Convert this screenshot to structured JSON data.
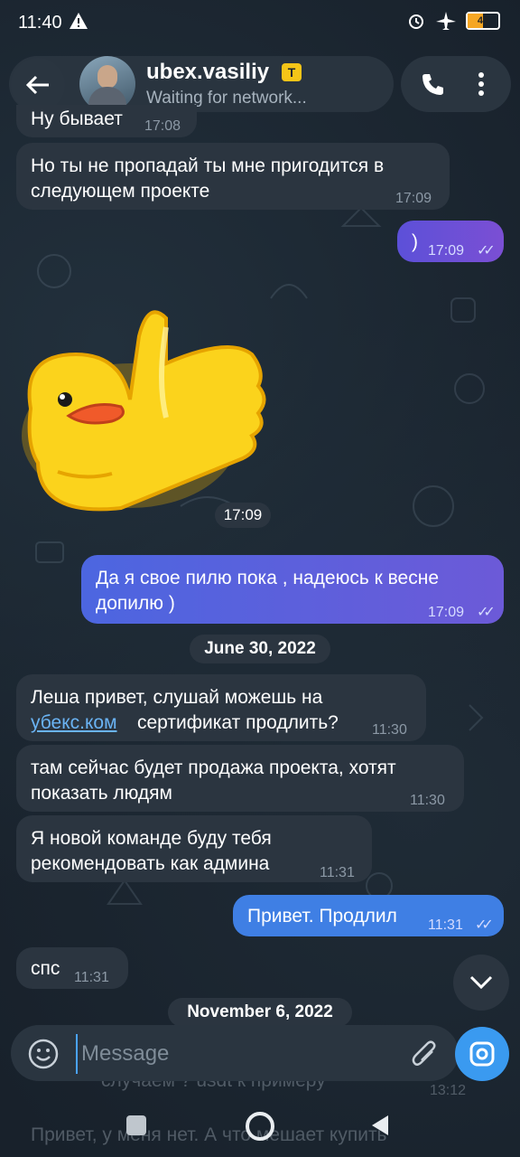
{
  "status_bar": {
    "time": "11:40",
    "battery": "49"
  },
  "header": {
    "name": "ubex.vasiliy",
    "badge": "T",
    "status": "Waiting for network..."
  },
  "messages": [
    {
      "text": "Ну бывает",
      "time": "17:08"
    },
    {
      "text": "Но ты не пропадай ты мне пригодится в\nследующем проекте",
      "time": "17:09"
    },
    {
      "text": ")",
      "time": "17:09"
    },
    {
      "time": "17:09"
    },
    {
      "text": "Да я свое пилю пока , надеюсь к весне\nдопилю )",
      "time": "17:09"
    },
    {
      "text_before": "Леша привет, слушай можешь на",
      "link": "убекс.ком",
      "text_after": "сертификат продлить?",
      "time": "11:30"
    },
    {
      "text": "там сейчас будет продажа проекта, хотят\nпоказать людям",
      "time": "11:30"
    },
    {
      "text": "Я новой команде буду тебя\nрекомендовать как админа",
      "time": "11:31"
    },
    {
      "text": "Привет. Продлил",
      "time": "11:31"
    },
    {
      "text": "спс",
      "time": "11:31"
    }
  ],
  "date_separators": [
    "June 30, 2022",
    "November 6, 2022"
  ],
  "ghost_lines": {
    "line1": "случаем ? usdt к примеру",
    "time1": "13:12",
    "line2": "Привет, у меня нет. А что мешает купить"
  },
  "input": {
    "placeholder": "Message"
  },
  "colors": {
    "accent": "#3a9af0",
    "outgoing": "#6c50d8",
    "incoming": "#2b3540"
  }
}
